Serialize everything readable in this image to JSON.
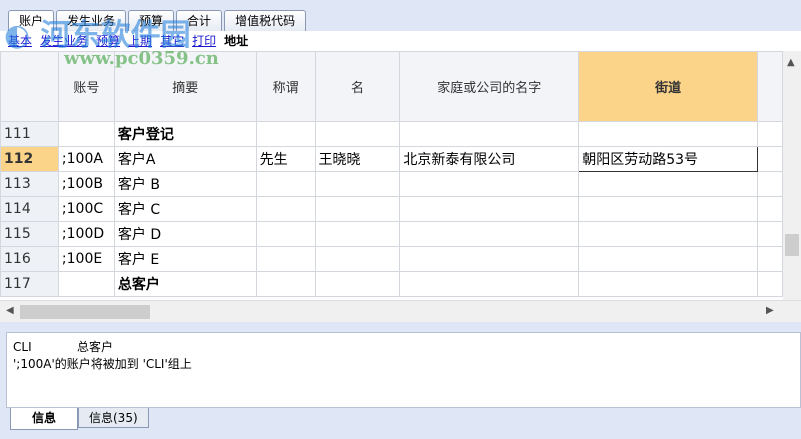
{
  "tabs": [
    "账户",
    "发生业务",
    "预算",
    "合计",
    "增值税代码"
  ],
  "subnav": {
    "links": [
      "基本",
      "发生业务",
      "预算",
      "上期",
      "其它",
      "打印"
    ],
    "current": "地址"
  },
  "columns": [
    "",
    "账号",
    "摘要",
    "称谓",
    "名",
    "家庭或公司的名字",
    "街道",
    ""
  ],
  "rows": [
    {
      "n": "111",
      "acc": "",
      "desc": "客户登记",
      "title": "",
      "first": "",
      "company": "",
      "street": "",
      "bold": true
    },
    {
      "n": "112",
      "acc": ";100A",
      "desc": "客户A",
      "title": "先生",
      "first": "王晓晓",
      "company": "北京新泰有限公司",
      "street": "朝阳区劳动路53号"
    },
    {
      "n": "113",
      "acc": ";100B",
      "desc": "客户 B",
      "title": "",
      "first": "",
      "company": "",
      "street": ""
    },
    {
      "n": "114",
      "acc": ";100C",
      "desc": "客户 C",
      "title": "",
      "first": "",
      "company": "",
      "street": ""
    },
    {
      "n": "115",
      "acc": ";100D",
      "desc": "客户 D",
      "title": "",
      "first": "",
      "company": "",
      "street": ""
    },
    {
      "n": "116",
      "acc": ";100E",
      "desc": "客户 E",
      "title": "",
      "first": "",
      "company": "",
      "street": ""
    },
    {
      "n": "117",
      "acc": "",
      "desc": "总客户",
      "title": "",
      "first": "",
      "company": "",
      "street": "",
      "bold": true
    }
  ],
  "messages": {
    "line1_code": "CLI",
    "line1_text": "总客户",
    "line2": "';100A'的账户将被加到 'CLI'组上"
  },
  "bottom_tabs": [
    "信息",
    "信息(35)"
  ],
  "watermark": "河东软件园 www.pc0359.cn"
}
